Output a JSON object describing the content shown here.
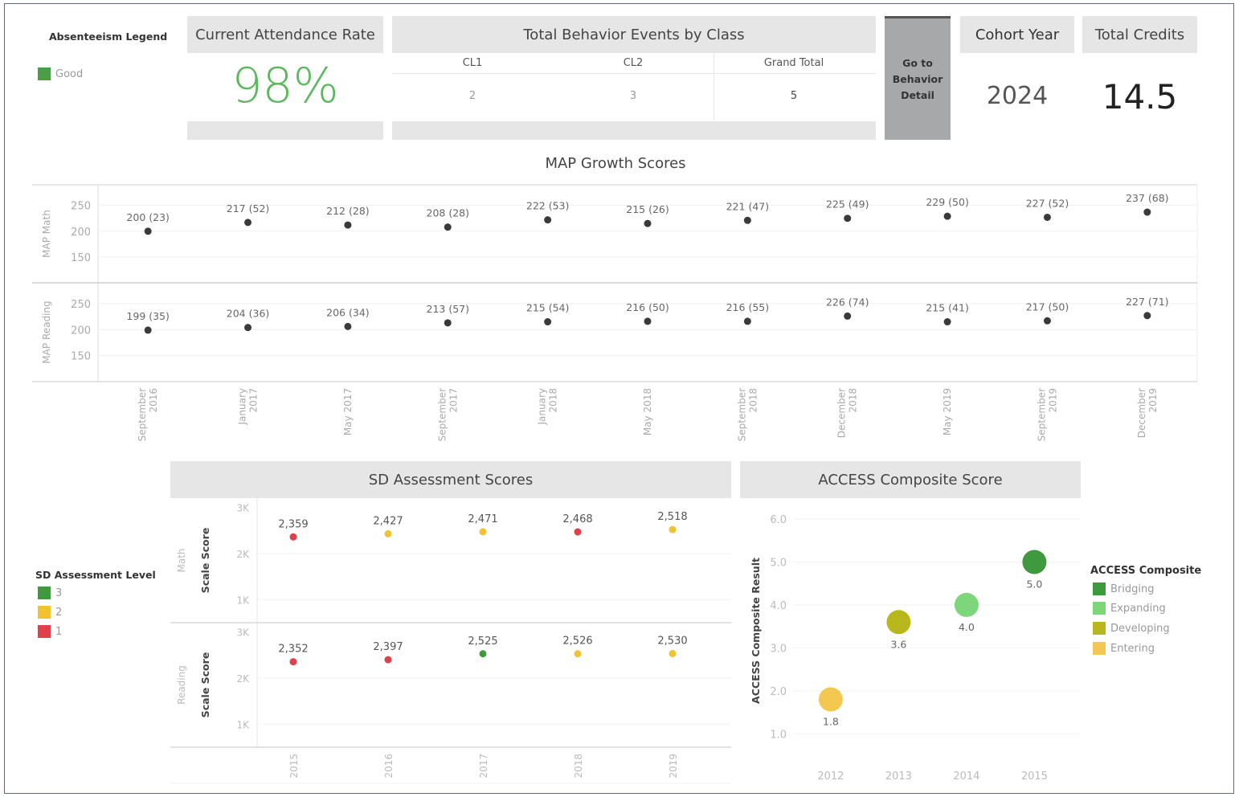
{
  "absenteeism_legend": {
    "title": "Absenteeism Legend",
    "items": [
      {
        "label": "Good",
        "color": "#4a9e45"
      }
    ]
  },
  "attendance": {
    "header": "Current Attendance Rate",
    "value": "98%",
    "color": "#5cb85c"
  },
  "behavior": {
    "header": "Total Behavior Events by Class",
    "columns": [
      "CL1",
      "CL2",
      "Grand Total"
    ],
    "values": [
      "2",
      "3",
      "5"
    ]
  },
  "behavior_button": {
    "label_lines": [
      "Go to",
      "Behavior",
      "Detail"
    ]
  },
  "cohort": {
    "header": "Cohort Year",
    "value": "2024"
  },
  "credits": {
    "header": "Total Credits",
    "value": "14.5"
  },
  "sd_legend": {
    "title": "SD Assessment Level",
    "items": [
      {
        "label": "3",
        "color": "#3f9a3f"
      },
      {
        "label": "2",
        "color": "#f2c230"
      },
      {
        "label": "1",
        "color": "#e0404a"
      }
    ]
  },
  "access_legend": {
    "title": "ACCESS Composite",
    "items": [
      {
        "label": "Bridging",
        "color": "#3f9a3f"
      },
      {
        "label": "Expanding",
        "color": "#7ed67a"
      },
      {
        "label": "Developing",
        "color": "#b8b81c"
      },
      {
        "label": "Entering",
        "color": "#f2c84e"
      }
    ]
  },
  "chart_data": [
    {
      "type": "scatter",
      "title": "MAP Growth Scores",
      "categories": [
        "September 2016",
        "January 2017",
        "May 2017",
        "September 2017",
        "January 2018",
        "May 2018",
        "September 2018",
        "December 2018",
        "May 2019",
        "September 2019",
        "December 2019"
      ],
      "ylim": [
        100,
        290
      ],
      "yticks": [
        "250",
        "200",
        "150"
      ],
      "ytick_values": [
        250,
        200,
        150
      ],
      "grid": true,
      "series": [
        {
          "name": "MAP Math",
          "values": [
            200,
            217,
            212,
            208,
            222,
            215,
            221,
            225,
            229,
            227,
            237
          ],
          "percentiles": [
            23,
            52,
            28,
            28,
            53,
            26,
            47,
            49,
            50,
            52,
            68
          ],
          "labels": [
            "200 (23)",
            "217 (52)",
            "212 (28)",
            "208 (28)",
            "222 (53)",
            "215 (26)",
            "221 (47)",
            "225 (49)",
            "229 (50)",
            "227 (52)",
            "237 (68)"
          ]
        },
        {
          "name": "MAP Reading",
          "values": [
            199,
            204,
            206,
            213,
            215,
            216,
            216,
            226,
            215,
            217,
            227
          ],
          "percentiles": [
            35,
            36,
            34,
            57,
            54,
            50,
            55,
            74,
            41,
            50,
            71
          ],
          "labels": [
            "199 (35)",
            "204 (36)",
            "206 (34)",
            "213 (57)",
            "215 (54)",
            "216 (50)",
            "216 (55)",
            "226 (74)",
            "215 (41)",
            "217 (50)",
            "227 (71)"
          ]
        }
      ]
    },
    {
      "type": "scatter",
      "title": "SD Assessment Scores",
      "categories": [
        "2015",
        "2016",
        "2017",
        "2018",
        "2019"
      ],
      "ylabel": "Scale Score",
      "ylim": [
        500,
        3200
      ],
      "yticks": [
        "3K",
        "2K",
        "1K"
      ],
      "ytick_values": [
        3000,
        2000,
        1000
      ],
      "grid": true,
      "legend": "left",
      "series": [
        {
          "name": "Math",
          "values": [
            2359,
            2427,
            2471,
            2468,
            2518
          ],
          "labels": [
            "2,359",
            "2,427",
            "2,471",
            "2,468",
            "2,518"
          ],
          "levels": [
            1,
            2,
            2,
            1,
            2
          ]
        },
        {
          "name": "Reading",
          "values": [
            2352,
            2397,
            2525,
            2526,
            2530
          ],
          "labels": [
            "2,352",
            "2,397",
            "2,525",
            "2,526",
            "2,530"
          ],
          "levels": [
            1,
            1,
            3,
            2,
            2
          ]
        }
      ]
    },
    {
      "type": "scatter",
      "title": "ACCESS Composite Score",
      "categories": [
        "2012",
        "2013",
        "2014",
        "2015"
      ],
      "ylabel": "ACCESS Composite Result",
      "ylim": [
        0.5,
        6.3
      ],
      "yticks": [
        "6.0",
        "5.0",
        "4.0",
        "3.0",
        "2.0",
        "1.0"
      ],
      "ytick_values": [
        6,
        5,
        4,
        3,
        2,
        1
      ],
      "grid": true,
      "legend": "right",
      "values": [
        1.8,
        3.6,
        4.0,
        5.0
      ],
      "labels": [
        "1.8",
        "3.6",
        "4.0",
        "5.0"
      ],
      "levels": [
        "Entering",
        "Developing",
        "Expanding",
        "Bridging"
      ]
    }
  ]
}
